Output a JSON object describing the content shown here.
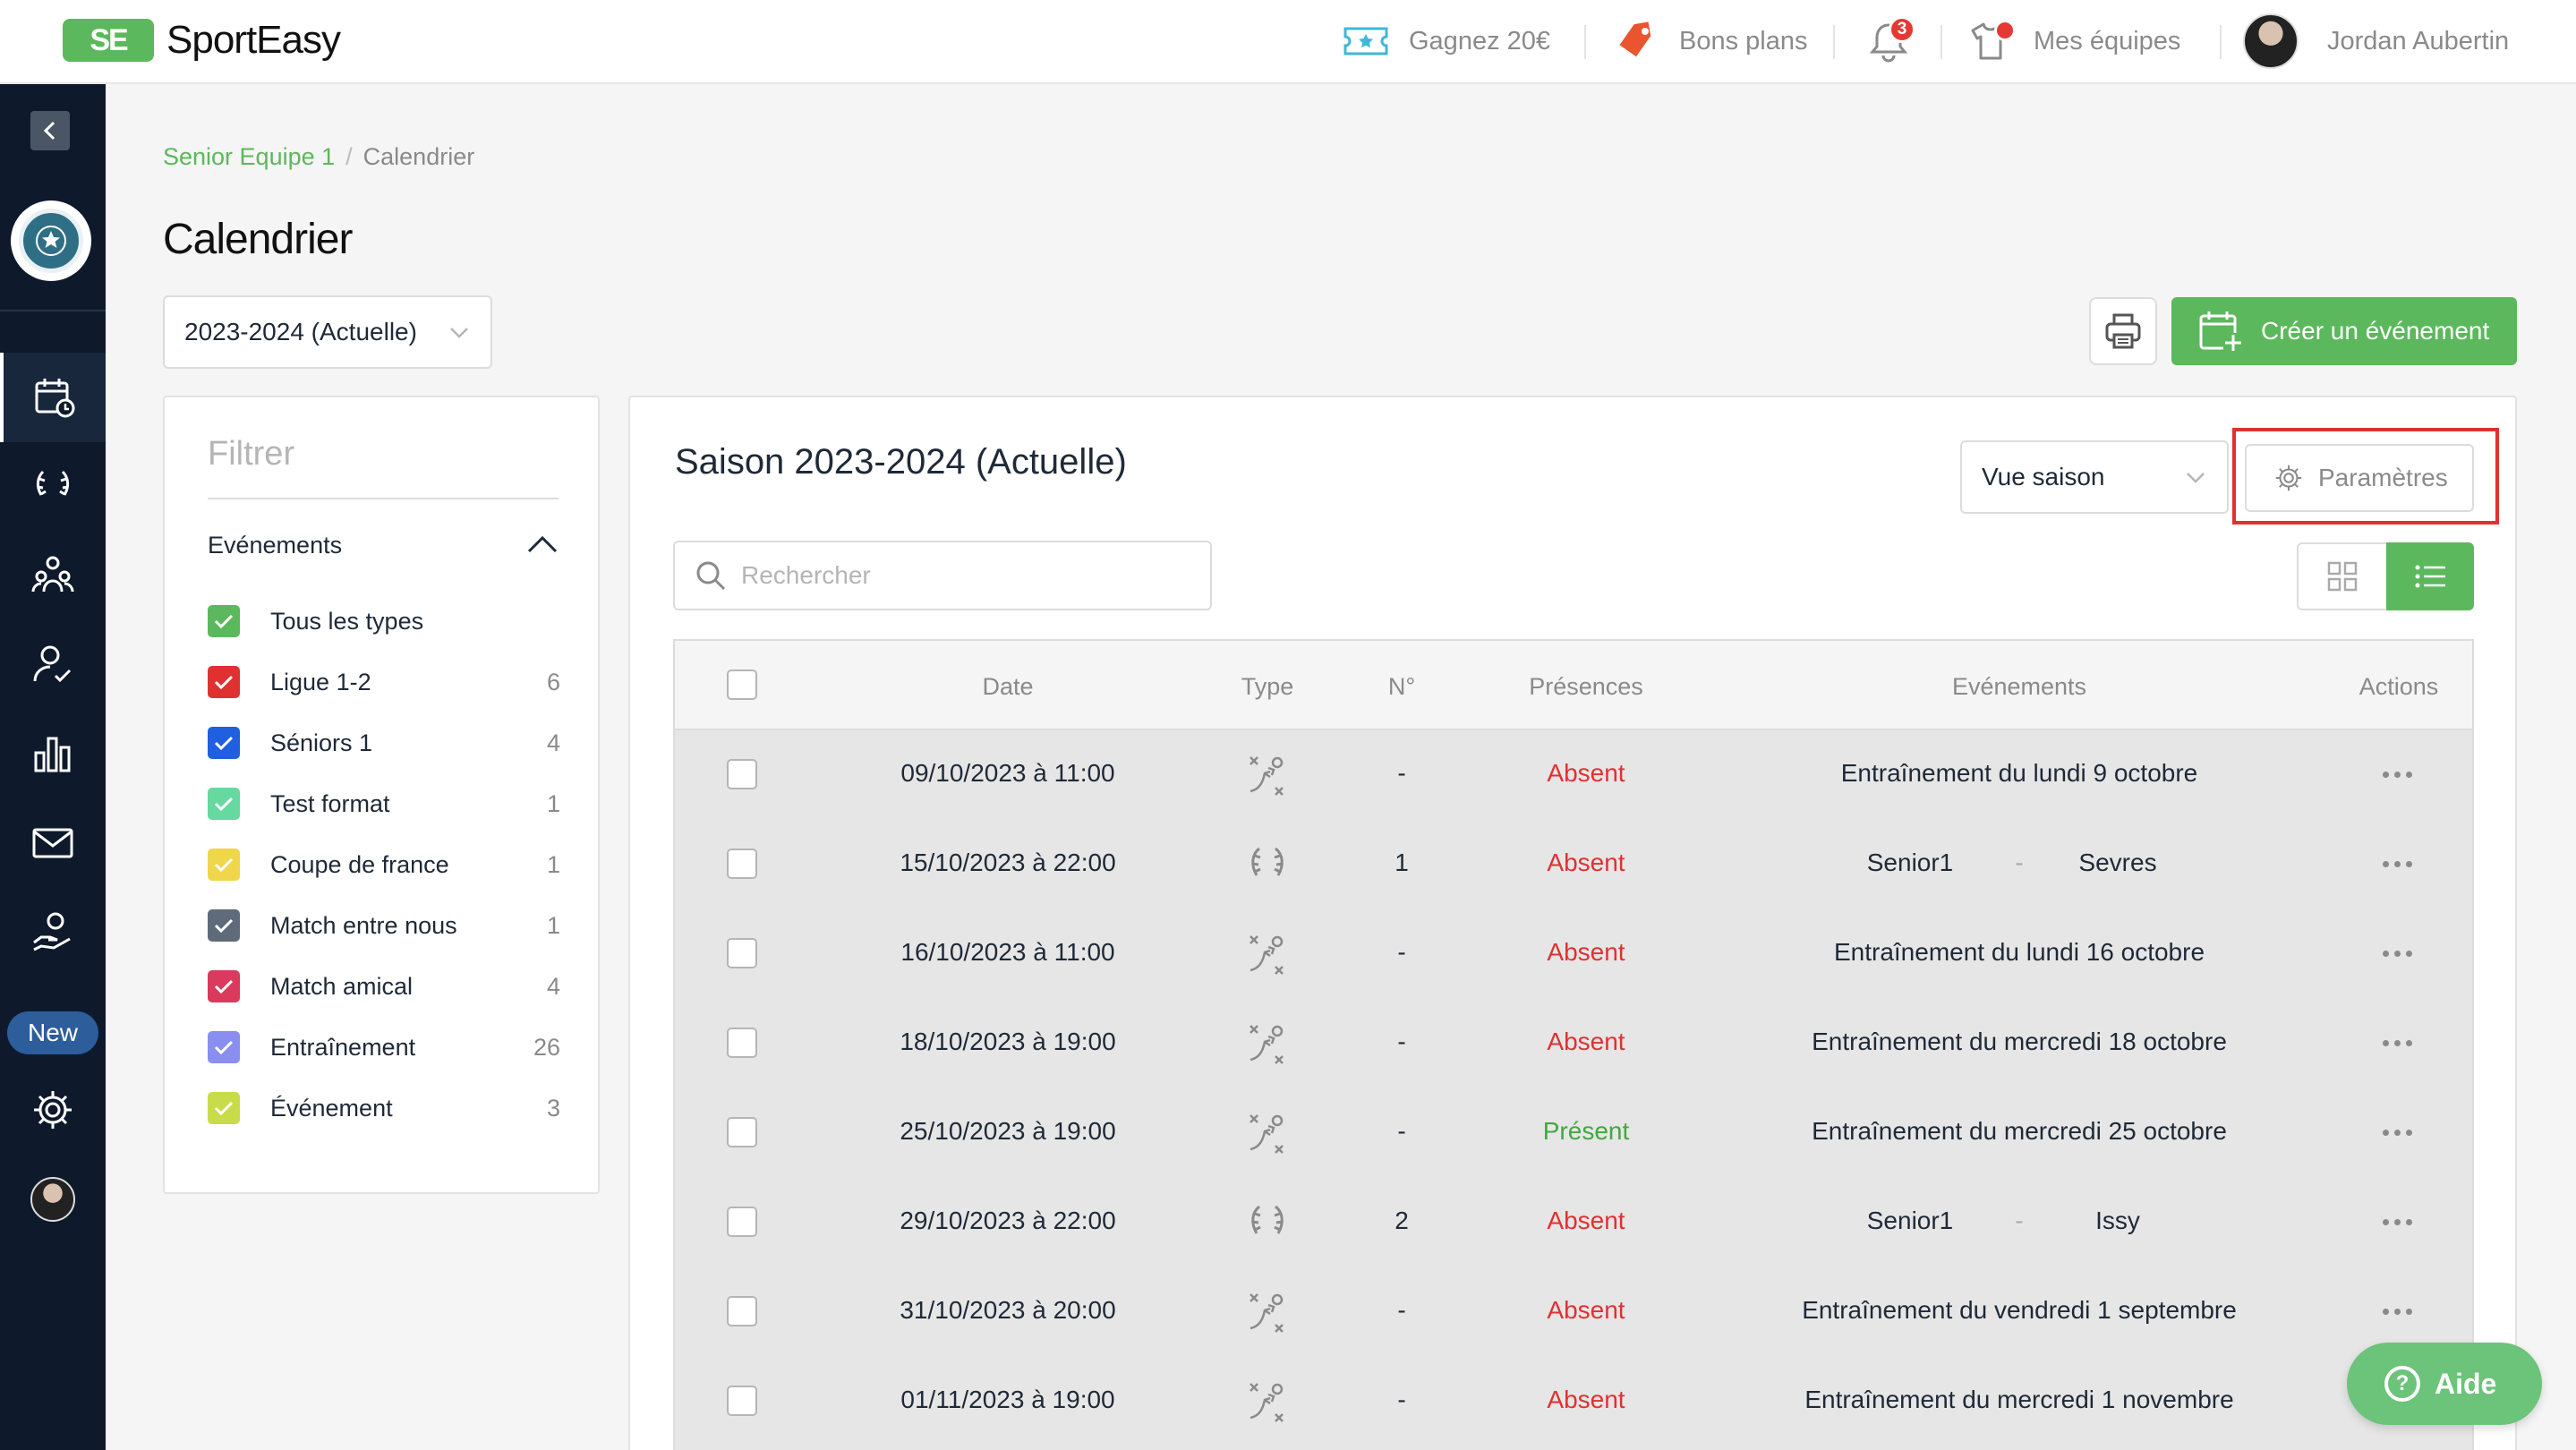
{
  "brand": {
    "logo_mark": "SE",
    "name": "SportEasy"
  },
  "topbar": {
    "earn": "Gagnez 20€",
    "deals": "Bons plans",
    "notifications_count": "3",
    "teams": "Mes équipes",
    "user_name": "Jordan Aubertin"
  },
  "sidebar": {
    "new_label": "New"
  },
  "breadcrumb": {
    "team": "Senior Equipe 1",
    "page": "Calendrier"
  },
  "page": {
    "title": "Calendrier",
    "season_select": "2023-2024 (Actuelle)",
    "create_button": "Créer un événement"
  },
  "filter": {
    "title": "Filtrer",
    "section": "Evénements",
    "items": [
      {
        "label": "Tous les types",
        "count": "",
        "color": "#5cb85c"
      },
      {
        "label": "Ligue 1-2",
        "count": "6",
        "color": "#e03131"
      },
      {
        "label": "Séniors 1",
        "count": "4",
        "color": "#1f5fe0"
      },
      {
        "label": "Test format",
        "count": "1",
        "color": "#66d9a0"
      },
      {
        "label": "Coupe de france",
        "count": "1",
        "color": "#f0d64a"
      },
      {
        "label": "Match entre nous",
        "count": "1",
        "color": "#5f6b7a"
      },
      {
        "label": "Match amical",
        "count": "4",
        "color": "#d93a5e"
      },
      {
        "label": "Entraînement",
        "count": "26",
        "color": "#8a8ef0"
      },
      {
        "label": "Événement",
        "count": "3",
        "color": "#c8dc4a"
      }
    ]
  },
  "main": {
    "heading": "Saison 2023-2024 (Actuelle)",
    "view_select": "Vue saison",
    "params_button": "Paramètres",
    "search_placeholder": "Rechercher"
  },
  "table": {
    "headers": {
      "date": "Date",
      "type": "Type",
      "number": "N°",
      "presence": "Présences",
      "events": "Evénements",
      "actions": "Actions"
    },
    "rows": [
      {
        "date": "09/10/2023 à 11:00",
        "type_icon": "training-icon",
        "number": "-",
        "presence": "Absent",
        "event": "Entraînement du lundi 9 octobre",
        "home": "",
        "dash": "",
        "away": ""
      },
      {
        "date": "15/10/2023 à 22:00",
        "type_icon": "laurel-icon",
        "number": "1",
        "presence": "Absent",
        "event": "",
        "home": "Senior1",
        "dash": "-",
        "away": "Sevres"
      },
      {
        "date": "16/10/2023 à 11:00",
        "type_icon": "training-icon",
        "number": "-",
        "presence": "Absent",
        "event": "Entraînement du lundi 16 octobre",
        "home": "",
        "dash": "",
        "away": ""
      },
      {
        "date": "18/10/2023 à 19:00",
        "type_icon": "training-icon",
        "number": "-",
        "presence": "Absent",
        "event": "Entraînement du mercredi 18 octobre",
        "home": "",
        "dash": "",
        "away": ""
      },
      {
        "date": "25/10/2023 à 19:00",
        "type_icon": "training-icon",
        "number": "-",
        "presence": "Présent",
        "event": "Entraînement du mercredi 25 octobre",
        "home": "",
        "dash": "",
        "away": ""
      },
      {
        "date": "29/10/2023 à 22:00",
        "type_icon": "laurel-icon",
        "number": "2",
        "presence": "Absent",
        "event": "",
        "home": "Senior1",
        "dash": "-",
        "away": "Issy"
      },
      {
        "date": "31/10/2023 à 20:00",
        "type_icon": "training-icon",
        "number": "-",
        "presence": "Absent",
        "event": "Entraînement du vendredi 1 septembre",
        "home": "",
        "dash": "",
        "away": ""
      },
      {
        "date": "01/11/2023 à 19:00",
        "type_icon": "training-icon",
        "number": "-",
        "presence": "Absent",
        "event": "Entraînement du mercredi 1 novembre",
        "home": "",
        "dash": "",
        "away": ""
      }
    ]
  },
  "help": {
    "label": "Aide"
  }
}
